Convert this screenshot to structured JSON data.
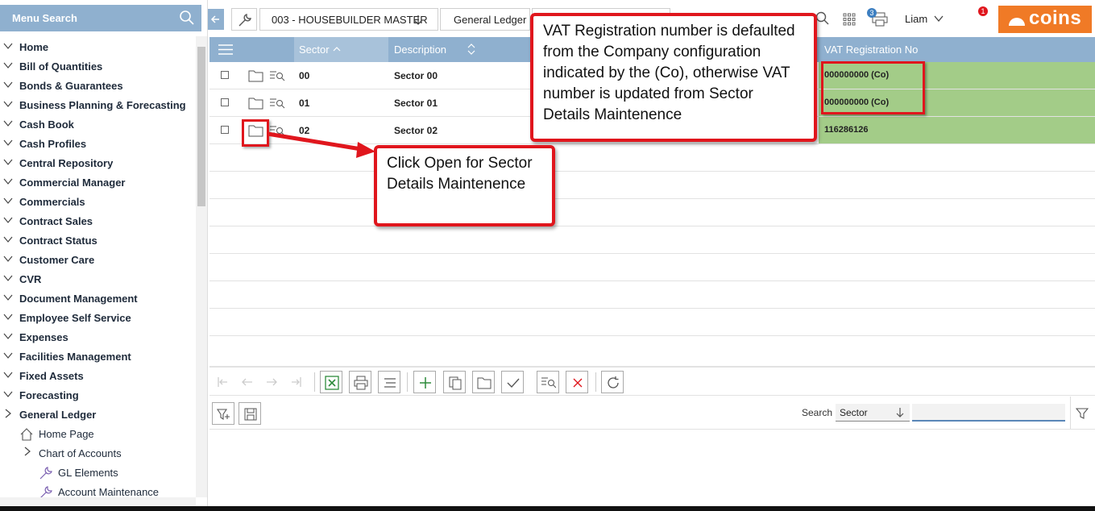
{
  "sidebar": {
    "menu_search_label": "Menu Search",
    "items": [
      {
        "label": "Home"
      },
      {
        "label": "Bill of Quantities"
      },
      {
        "label": "Bonds & Guarantees"
      },
      {
        "label": "Business Planning & Forecasting"
      },
      {
        "label": "Cash Book"
      },
      {
        "label": "Cash Profiles"
      },
      {
        "label": "Central Repository"
      },
      {
        "label": "Commercial Manager"
      },
      {
        "label": "Commercials"
      },
      {
        "label": "Contract Sales"
      },
      {
        "label": "Contract Status"
      },
      {
        "label": "Customer Care"
      },
      {
        "label": "CVR"
      },
      {
        "label": "Document Management"
      },
      {
        "label": "Employee Self Service"
      },
      {
        "label": "Expenses"
      },
      {
        "label": "Facilities Management"
      },
      {
        "label": "Fixed Assets"
      },
      {
        "label": "Forecasting"
      },
      {
        "label": "General Ledger"
      }
    ],
    "sub_items": [
      {
        "label": "Home Page",
        "icon": "home-icon"
      },
      {
        "label": "Chart of Accounts",
        "icon": "chevron-right-icon"
      },
      {
        "label": "GL Elements",
        "icon": "wrench-icon"
      },
      {
        "label": "Account Maintenance",
        "icon": "wrench-icon"
      }
    ]
  },
  "header": {
    "company": "003 - HOUSEBUILDER MASTER",
    "module": "General Ledger",
    "user": "Liam",
    "print_badge": "3",
    "notification_badge": "1",
    "logo_text": "coins",
    "logo_color": "#f07a26"
  },
  "grid": {
    "columns": {
      "sector": "Sector",
      "description": "Description",
      "vat": "VAT Registration No"
    },
    "rows": [
      {
        "sector": "00",
        "description": "Sector 00",
        "vat": "000000000 (Co)"
      },
      {
        "sector": "01",
        "description": "Sector 01",
        "vat": "000000000 (Co)"
      },
      {
        "sector": "02",
        "description": "Sector 02",
        "vat": "116286126"
      }
    ]
  },
  "filter": {
    "search_label": "Search",
    "search_field": "Sector"
  },
  "callouts": {
    "vat_note": "VAT Registration number is defaulted from the Company configuration indicated by the (Co), otherwise VAT number is updated from Sector Details Maintenence",
    "open_note": "Click Open for Sector Details Maintenence"
  },
  "colors": {
    "header_blue": "#8fb0cf",
    "vat_green": "#a3cc88",
    "callout_red": "#e0161d"
  }
}
